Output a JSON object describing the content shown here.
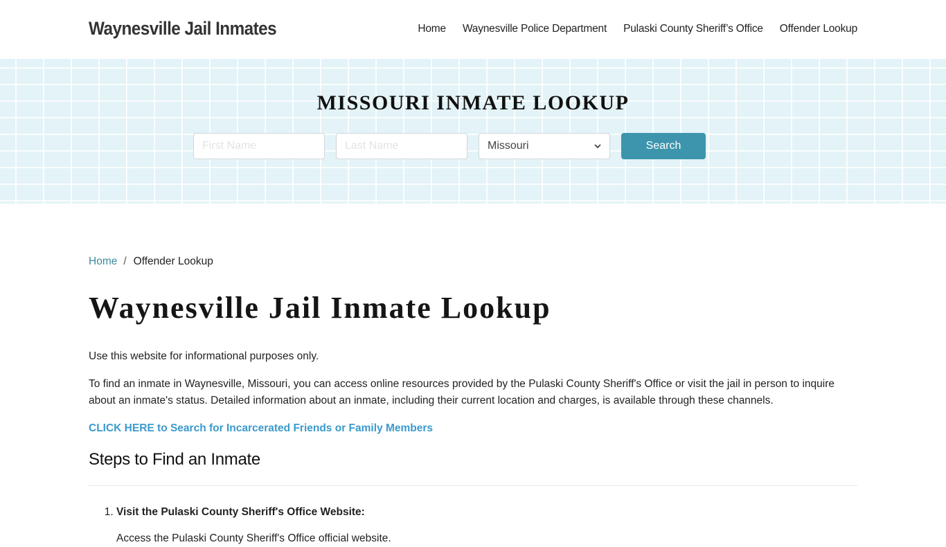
{
  "header": {
    "brand": "Waynesville Jail Inmates",
    "nav": [
      {
        "label": "Home"
      },
      {
        "label": "Waynesville Police Department"
      },
      {
        "label": "Pulaski County Sheriff’s Office"
      },
      {
        "label": "Offender Lookup"
      }
    ]
  },
  "hero": {
    "title": "MISSOURI INMATE LOOKUP",
    "first_name_placeholder": "First Name",
    "last_name_placeholder": "Last Name",
    "state_selected": "Missouri",
    "search_label": "Search"
  },
  "breadcrumb": {
    "home": "Home",
    "separator": "/",
    "current": "Offender Lookup"
  },
  "main": {
    "title": "Waynesville Jail Inmate Lookup",
    "p1": "Use this website for informational purposes only.",
    "p2": "To find an inmate in Waynesville, Missouri, you can access online resources provided by the Pulaski County Sheriff's Office or visit the jail in person to inquire about an inmate's status. Detailed information about an inmate, including their current location and charges, is available through these channels.",
    "cta": "CLICK HERE to Search for Incarcerated Friends or Family Members",
    "steps_heading": "Steps to Find an Inmate",
    "steps": [
      {
        "label": "Visit the Pulaski County Sheriff's Office Website:"
      }
    ],
    "sub_items": [
      {
        "label": "Access the Pulaski County Sheriff's Office official website."
      }
    ]
  },
  "colors": {
    "accent": "#3d95ad",
    "link": "#3a9acd",
    "breadcrumb_link": "#3b8a9e",
    "hero_bg": "#e3f3f7"
  }
}
